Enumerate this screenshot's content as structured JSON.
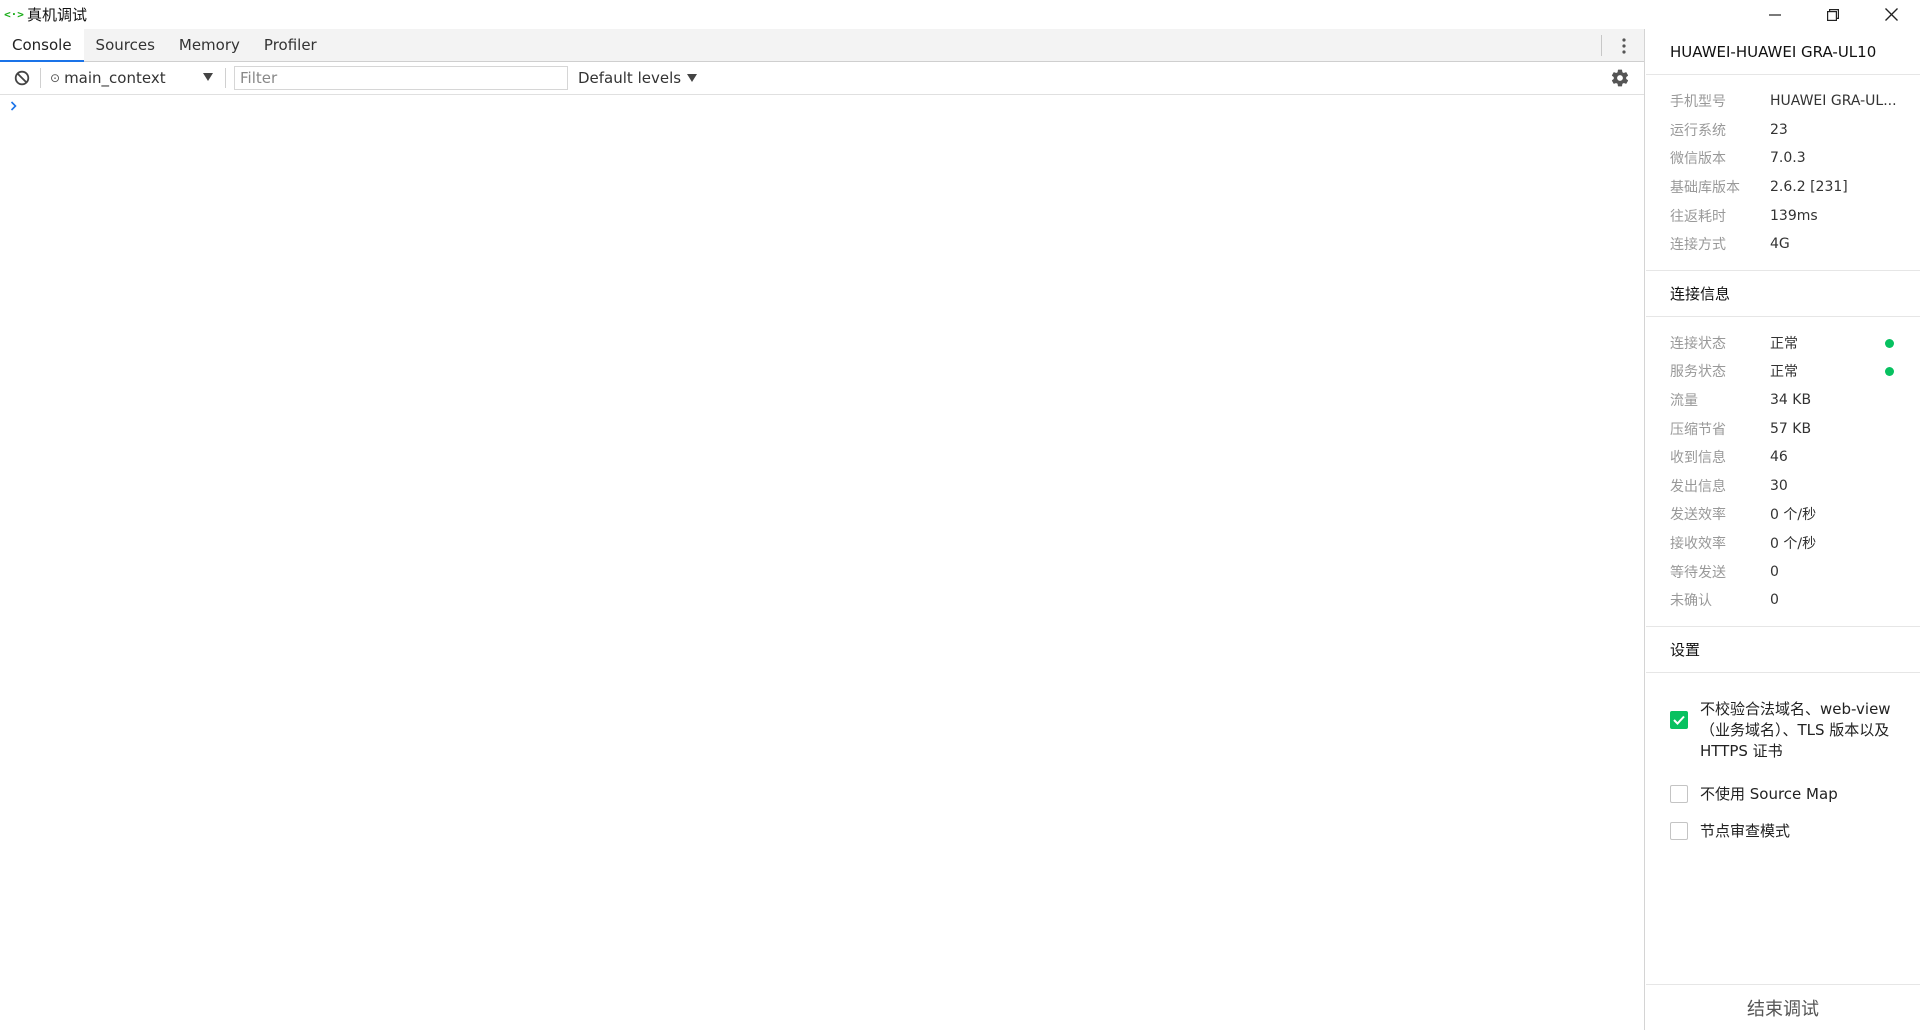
{
  "window": {
    "title": "真机调试",
    "app_icon": "<·>"
  },
  "icons": {
    "app": "code-brackets-icon",
    "minimize": "minimize-icon",
    "restore": "restore-icon",
    "close": "close-icon",
    "more": "vertical-dots-icon",
    "clear": "block-icon",
    "settings": "gear-icon",
    "prompt": "chevron-right-icon"
  },
  "colors": {
    "accent_tab": "#1a73e8",
    "status_ok": "#07c160",
    "checkbox_checked": "#07c160"
  },
  "devtools": {
    "tabs": [
      {
        "label": "Console",
        "active": true
      },
      {
        "label": "Sources",
        "active": false
      },
      {
        "label": "Memory",
        "active": false
      },
      {
        "label": "Profiler",
        "active": false
      }
    ],
    "toolbar": {
      "context_icon": "⊙",
      "context": "main_context",
      "filter_placeholder": "Filter",
      "filter_value": "",
      "levels": "Default levels"
    },
    "prompt_symbol": "›"
  },
  "device": {
    "title": "HUAWEI-HUAWEI GRA-UL10",
    "info": [
      {
        "key": "手机型号",
        "value": "HUAWEI GRA-UL..."
      },
      {
        "key": "运行系统",
        "value": "23"
      },
      {
        "key": "微信版本",
        "value": "7.0.3"
      },
      {
        "key": "基础库版本",
        "value": "2.6.2 [231]"
      },
      {
        "key": "往返耗时",
        "value": "139ms"
      },
      {
        "key": "连接方式",
        "value": "4G"
      }
    ]
  },
  "connection": {
    "heading": "连接信息",
    "info": [
      {
        "key": "连接状态",
        "value": "正常",
        "status": "ok"
      },
      {
        "key": "服务状态",
        "value": "正常",
        "status": "ok"
      },
      {
        "key": "流量",
        "value": "34 KB"
      },
      {
        "key": "压缩节省",
        "value": "57 KB"
      },
      {
        "key": "收到信息",
        "value": "46"
      },
      {
        "key": "发出信息",
        "value": "30"
      },
      {
        "key": "发送效率",
        "value": "0 个/秒"
      },
      {
        "key": "接收效率",
        "value": "0 个/秒"
      },
      {
        "key": "等待发送",
        "value": "0"
      },
      {
        "key": "未确认",
        "value": "0"
      }
    ]
  },
  "settings": {
    "heading": "设置",
    "options": [
      {
        "label": "不校验合法域名、web-view（业务域名）、TLS 版本以及 HTTPS 证书",
        "checked": true
      },
      {
        "label": "不使用 Source Map",
        "checked": false
      },
      {
        "label": "节点审查模式",
        "checked": false
      }
    ]
  },
  "footer": {
    "end_debug": "结束调试"
  }
}
